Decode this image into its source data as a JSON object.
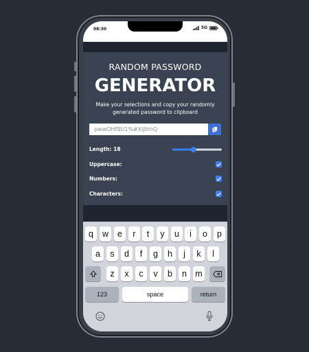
{
  "status": {
    "time": "08:30",
    "network": "5G"
  },
  "app": {
    "title_small": "RANDOM PASSWORD",
    "title_large": "GENERATOR",
    "description": "Make your selections and copy your randomly generated password to clipboard",
    "password": "pwwOHf9U1%#XljIhhQ",
    "length_label": "Length: 18",
    "length_value": 18,
    "options": [
      {
        "label": "Uppercase:",
        "checked": true
      },
      {
        "label": "Numbers:",
        "checked": true
      },
      {
        "label": "Characters:",
        "checked": true
      }
    ],
    "colors": {
      "card": "#394251",
      "accent": "#3f6fd6"
    }
  },
  "keyboard": {
    "row1": [
      "q",
      "w",
      "e",
      "r",
      "t",
      "y",
      "u",
      "i",
      "o",
      "p"
    ],
    "row2": [
      "a",
      "s",
      "d",
      "f",
      "g",
      "h",
      "j",
      "k",
      "l"
    ],
    "row3": [
      "z",
      "x",
      "c",
      "v",
      "b",
      "n",
      "m"
    ],
    "numbers_label": "123",
    "space_label": "space",
    "return_label": "return",
    "icons": [
      "shift-icon",
      "backspace-icon",
      "emoji-icon",
      "microphone-icon"
    ]
  }
}
